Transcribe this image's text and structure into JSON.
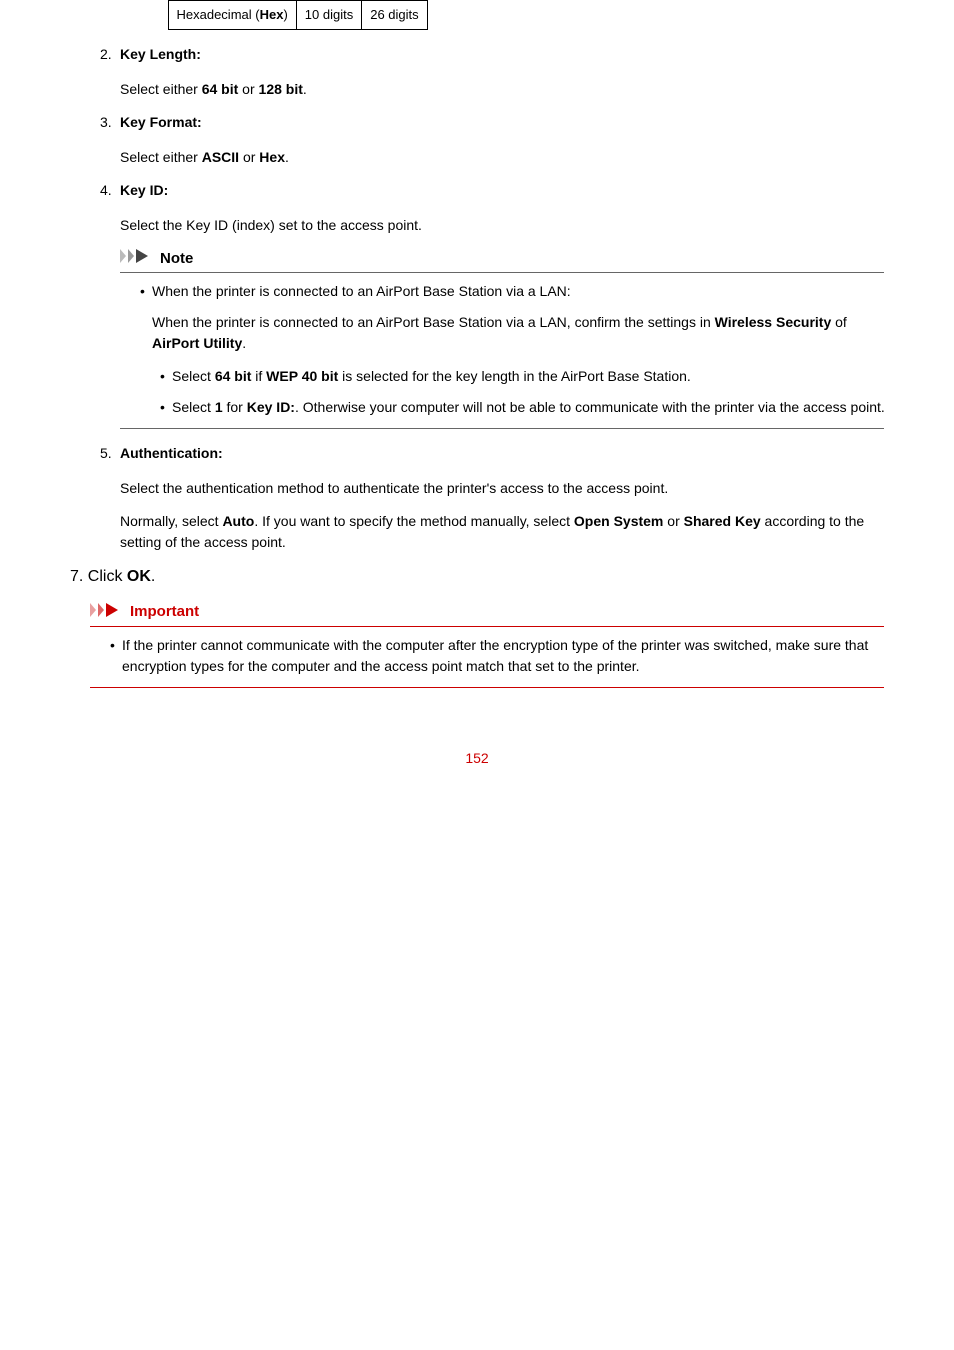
{
  "table": {
    "c1": "Hexadecimal (",
    "c1b": "Hex",
    "c1c": ")",
    "c2": "10 digits",
    "c3": "26 digits"
  },
  "items": {
    "i2": {
      "num": "2.",
      "title": "Key Length:",
      "body": "Select either ",
      "b1": "64 bit",
      "mid": " or ",
      "b2": "128 bit",
      "end": "."
    },
    "i3": {
      "num": "3.",
      "title": "Key Format:",
      "body": "Select either ",
      "b1": "ASCII",
      "mid": " or ",
      "b2": "Hex",
      "end": "."
    },
    "i4": {
      "num": "4.",
      "title": "Key ID:",
      "body": "Select the Key ID (index) set to the access point."
    },
    "i5": {
      "num": "5.",
      "title": "Authentication:",
      "body1": "Select the authentication method to authenticate the printer's access to the access point.",
      "body2a": "Normally, select ",
      "body2b": "Auto",
      "body2c": ". If you want to specify the method manually, select ",
      "body2d": "Open System",
      "body2e": " or ",
      "body2f": "Shared Key",
      "body2g": " according to the setting of the access point."
    }
  },
  "note": {
    "label": "Note",
    "bullet1": "When the printer is connected to an AirPort Base Station via a LAN:",
    "line1a": "When the printer is connected to an AirPort Base Station via a LAN, confirm the settings in ",
    "line1b": "Wireless Security",
    "line1c": " of ",
    "line1d": "AirPort Utility",
    "line1e": ".",
    "sb1a": "Select ",
    "sb1b": "64 bit",
    "sb1c": " if ",
    "sb1d": "WEP 40 bit",
    "sb1e": " is selected for the key length in the AirPort Base Station.",
    "sb2a": "Select ",
    "sb2b": "1",
    "sb2c": " for ",
    "sb2d": "Key ID:",
    "sb2e": ". Otherwise your computer will not be able to communicate with the printer via the access point."
  },
  "step7": {
    "num": "7.",
    "body": "Click ",
    "b": "OK",
    "end": "."
  },
  "important": {
    "label": "Important",
    "bullet": "If the printer cannot communicate with the computer after the encryption type of the printer was switched, make sure that encryption types for the computer and the access point match that set to the printer."
  },
  "pagenum": "152"
}
